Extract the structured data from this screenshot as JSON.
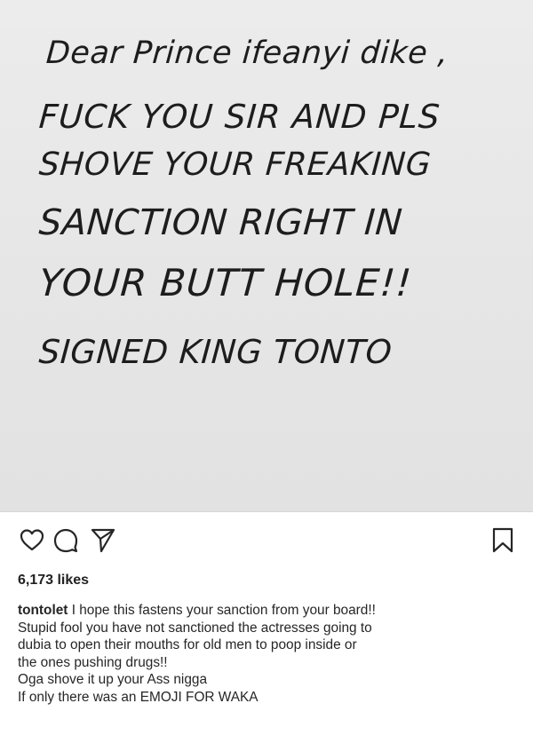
{
  "post": {
    "image_text": {
      "line1": "Dear Prince ifeanyi dike ,",
      "line2": "FUCK YOU SIR AND PLS",
      "line3": "SHOVE YOUR FREAKING",
      "line4": "SANCTION RIGHT IN",
      "line5": "YOUR BUTT HOLE!!",
      "line6": "SIGNED KING TONTO"
    }
  },
  "actions": {
    "like_icon": "heart-icon",
    "comment_icon": "comment-bubble-icon",
    "share_icon": "paper-plane-icon",
    "save_icon": "bookmark-icon"
  },
  "likes": {
    "count_label": "6,173 likes"
  },
  "caption": {
    "username": "tontolet",
    "line1_text": " I hope this fastens your sanction from your board!!",
    "line2": "Stupid fool you have not sanctioned the actresses going to",
    "line3": "dubia to open their mouths for old men to poop inside or",
    "line4": "the ones pushing drugs!!",
    "line5": "Oga shove it up your Ass nigga",
    "line6": "If only there was an EMOJI FOR WAKA"
  },
  "colors": {
    "image_background": "#e6e6e6",
    "text": "#262626",
    "icon_stroke": "#262626"
  }
}
